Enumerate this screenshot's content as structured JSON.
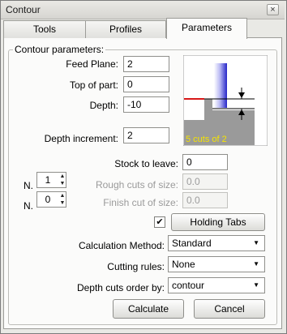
{
  "window": {
    "title": "Contour",
    "close_glyph": "×"
  },
  "tabs": [
    {
      "label": "Tools",
      "active": false
    },
    {
      "label": "Profiles",
      "active": false
    },
    {
      "label": "Parameters",
      "active": true
    }
  ],
  "group": {
    "title": "Contour parameters:"
  },
  "fields": {
    "feed_plane": {
      "label": "Feed Plane:",
      "value": "2"
    },
    "top_of_part": {
      "label": "Top of part:",
      "value": "0"
    },
    "depth": {
      "label": "Depth:",
      "value": "-10"
    },
    "depth_increment": {
      "label": "Depth increment:",
      "value": "2"
    },
    "stock_to_leave": {
      "label": "Stock to leave:",
      "value": "0"
    },
    "rough_cuts": {
      "label": "Rough cuts of size:",
      "value": "0.0"
    },
    "finish_cut": {
      "label": "Finish cut of size:",
      "value": "0.0"
    }
  },
  "diagram": {
    "caption": "5 cuts of 2"
  },
  "spinners": [
    {
      "label": "N.",
      "value": "1"
    },
    {
      "label": "N.",
      "value": "0"
    }
  ],
  "holding_tabs": {
    "checked": true,
    "check_glyph": "✔",
    "button_label": "Holding Tabs"
  },
  "combos": {
    "calculation_method": {
      "label": "Calculation Method:",
      "value": "Standard"
    },
    "cutting_rules": {
      "label": "Cutting rules:",
      "value": "None"
    },
    "depth_cuts_order": {
      "label": "Depth cuts order by:",
      "value": "contour"
    }
  },
  "buttons": {
    "calculate": "Calculate",
    "cancel": "Cancel"
  },
  "icons": {
    "combo_arrow": "▼",
    "spin_up": "▲",
    "spin_down": "▼"
  },
  "colors": {
    "window_bg": "#e9e9e5",
    "panel_bg": "#fbfbfa",
    "tool_blue": "#3a3ad8",
    "stock_gray": "#9a9a9a",
    "top_red": "#d81818",
    "caption_yellow": "#f5e400"
  }
}
